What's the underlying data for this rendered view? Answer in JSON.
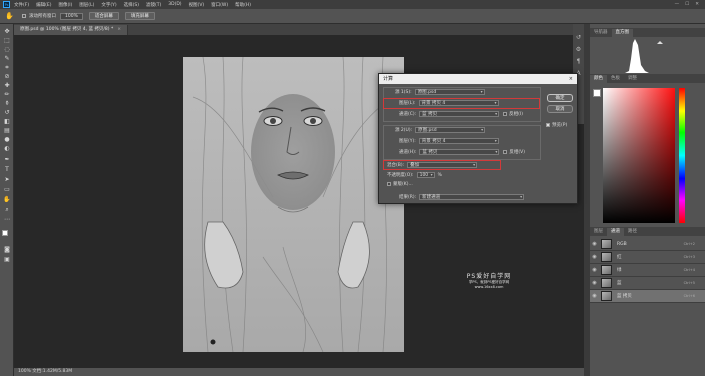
{
  "menubar": {
    "logo": "Ps",
    "items": [
      "文件(F)",
      "编辑(E)",
      "图像(I)",
      "图层(L)",
      "文字(Y)",
      "选择(S)",
      "滤镜(T)",
      "3D(D)",
      "视图(V)",
      "窗口(W)",
      "帮助(H)"
    ],
    "controls": [
      "—",
      "☐",
      "✕"
    ]
  },
  "options": {
    "tool_icon": "hand-icon",
    "scroll_all_windows": "滚动所有窗口",
    "zoom": "100%",
    "fit_screen": "适合屏幕",
    "fill_screen": "填充屏幕"
  },
  "document_tab": {
    "title": "原图.psd @ 100% (图层 拷贝 4, 蓝 拷贝/8) *",
    "close": "×"
  },
  "toolbar": {
    "icons": [
      "move-icon",
      "marquee-icon",
      "lasso-icon",
      "quick-select-icon",
      "crop-icon",
      "eyedropper-icon",
      "healing-icon",
      "brush-icon",
      "stamp-icon",
      "history-brush-icon",
      "eraser-icon",
      "gradient-icon",
      "blur-icon",
      "dodge-icon",
      "pen-icon",
      "type-icon",
      "path-select-icon",
      "rectangle-icon",
      "hand-icon",
      "zoom-icon",
      "more-icon"
    ]
  },
  "statusbar": {
    "text": "100%    文档:1.42M/5.83M"
  },
  "right_panel": {
    "top_tabs": [
      "导航器",
      "直方图"
    ],
    "color_tabs": [
      "颜色",
      "色板",
      "调整"
    ],
    "layers_tabs": [
      "图层",
      "通道",
      "路径"
    ],
    "channels": [
      {
        "name": "RGB",
        "shortcut": "Ctrl+2",
        "eye": "◉",
        "selected": false
      },
      {
        "name": "红",
        "shortcut": "Ctrl+3",
        "eye": "◉",
        "selected": false
      },
      {
        "name": "绿",
        "shortcut": "Ctrl+4",
        "eye": "◉",
        "selected": false
      },
      {
        "name": "蓝",
        "shortcut": "Ctrl+5",
        "eye": "◉",
        "selected": false
      },
      {
        "name": "蓝 拷贝",
        "shortcut": "Ctrl+6",
        "eye": "◉",
        "selected": true
      }
    ]
  },
  "dialog": {
    "title": "计算",
    "close": "×",
    "source1": {
      "label": "源 1(S):",
      "file": "原图.psd",
      "layer_label": "图层(L):",
      "layer": "背景 拷贝 4",
      "channel_label": "通道(C):",
      "channel": "蓝 拷贝",
      "invert": "反相(I)"
    },
    "source2": {
      "label": "源 2(U):",
      "file": "原图.psd",
      "layer_label": "图层(Y):",
      "layer": "背景 拷贝 4",
      "channel_label": "通道(H):",
      "channel": "蓝 拷贝",
      "invert": "反相(V)"
    },
    "blend_label": "混合(B):",
    "blend": "叠加",
    "opacity_label": "不透明度(O):",
    "opacity": "100",
    "opacity_unit": "%",
    "mask": "蒙版(K)...",
    "result_label": "结果(R):",
    "result": "新建通道",
    "ok": "确定",
    "cancel": "取消",
    "preview": "预览(P)"
  },
  "watermark": {
    "title": "PS爱好自学网",
    "subtitle": "学PS，就到PS爱好自学网",
    "url": "www.16xx8.com"
  },
  "colors": {
    "accent_red_box": "#d23a3a",
    "ps_blue": "#31a8ff"
  }
}
